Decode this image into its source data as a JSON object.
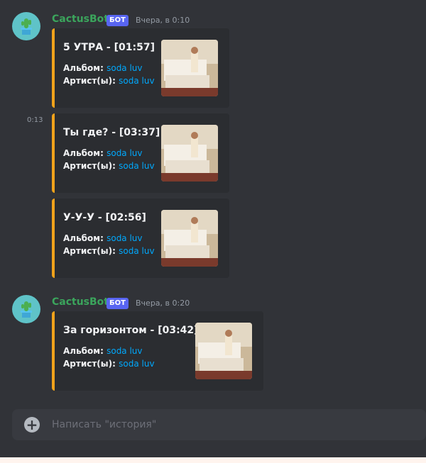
{
  "colors": {
    "accent_border": "#f0a21b",
    "link": "#00a8fc",
    "bot_tag": "#5865f2",
    "username": "#3ba55c"
  },
  "messages": [
    {
      "username": "CactusBot",
      "bot_tag": "БОТ",
      "timestamp": "Вчера, в 0:10",
      "embeds": [
        {
          "title": "5 УТРА - [01:57]",
          "album_label": "Альбом:",
          "album": "soda luv",
          "artist_label": "Артист(ы):",
          "artist": "soda luv"
        },
        {
          "side_time": "0:13",
          "title": "Ты где? - [03:37]",
          "album_label": "Альбом:",
          "album": "soda luv",
          "artist_label": "Артист(ы):",
          "artist": "soda luv"
        },
        {
          "title": "У-У-У - [02:56]",
          "album_label": "Альбом:",
          "album": "soda luv",
          "artist_label": "Артист(ы):",
          "artist": "soda luv"
        }
      ]
    },
    {
      "username": "CactusBot",
      "bot_tag": "БОТ",
      "timestamp": "Вчера, в 0:20",
      "embeds": [
        {
          "title": "За горизонтом - [03:42]",
          "album_label": "Альбом:",
          "album": "soda luv",
          "artist_label": "Артист(ы):",
          "artist": "soda luv"
        }
      ]
    }
  ],
  "composer": {
    "placeholder": "Написать \"история\"",
    "plus_icon": "plus-circle-icon"
  }
}
